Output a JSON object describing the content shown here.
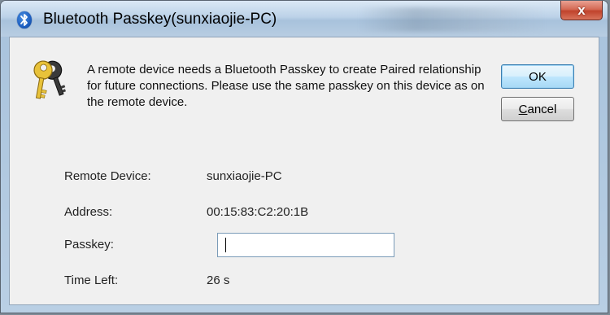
{
  "window": {
    "title": "Bluetooth Passkey(sunxiaojie-PC)",
    "close_glyph": "x"
  },
  "dialog": {
    "message": "A remote device needs a Bluetooth Passkey to create Paired relationship for future connections. Please use the same passkey on this device as on the remote device.",
    "ok_label": "OK",
    "cancel_mnemonic": "C",
    "cancel_rest": "ancel"
  },
  "fields": {
    "remote_device_label": "Remote Device:",
    "remote_device_value": "sunxiaojie-PC",
    "address_label": "Address:",
    "address_value": "00:15:83:C2:20:1B",
    "passkey_label": "Passkey:",
    "passkey_value": "",
    "time_left_label": "Time Left:",
    "time_left_value": "26 s"
  },
  "icons": {
    "title_icon": "bluetooth-icon",
    "dialog_icon": "keys-icon",
    "close_icon": "close-icon"
  },
  "colors": {
    "close_button": "#c0432c",
    "bluetooth_blue": "#1d5fc1",
    "key_gold": "#e8c23a"
  }
}
